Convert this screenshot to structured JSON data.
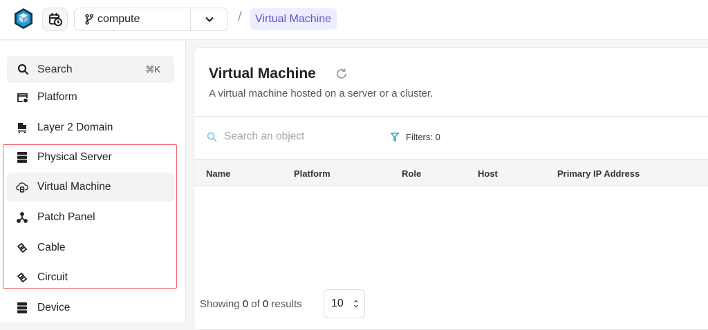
{
  "topbar": {
    "branch": "compute",
    "separator": "/",
    "breadcrumb": "Virtual Machine"
  },
  "sidebar": {
    "search": {
      "label": "Search",
      "shortcut": "⌘K"
    },
    "items": [
      {
        "label": "Platform",
        "icon": "platform-icon"
      },
      {
        "label": "Layer 2 Domain",
        "icon": "layer2-icon"
      },
      {
        "label": "Physical Server",
        "icon": "server-icon"
      },
      {
        "label": "Virtual Machine",
        "icon": "cloud-server-icon",
        "active": true
      },
      {
        "label": "Patch Panel",
        "icon": "patch-panel-icon"
      },
      {
        "label": "Cable",
        "icon": "cable-icon"
      },
      {
        "label": "Circuit",
        "icon": "circuit-icon"
      },
      {
        "label": "Device",
        "icon": "server-icon"
      }
    ]
  },
  "main": {
    "title": "Virtual Machine",
    "description": "A virtual machine hosted on a server or a cluster.",
    "search_placeholder": "Search an object",
    "filters": "Filters: 0",
    "columns": [
      "Name",
      "Platform",
      "Role",
      "Host",
      "Primary IP Address"
    ],
    "pagination": {
      "prefix": "Showing ",
      "shown": "0",
      "of": " of ",
      "total": "0",
      "suffix": " results",
      "page_size": "10"
    }
  },
  "colors": {
    "accent": "#5b52d6",
    "highlight": "#ef5f6c",
    "filter": "#3aa3c4"
  }
}
